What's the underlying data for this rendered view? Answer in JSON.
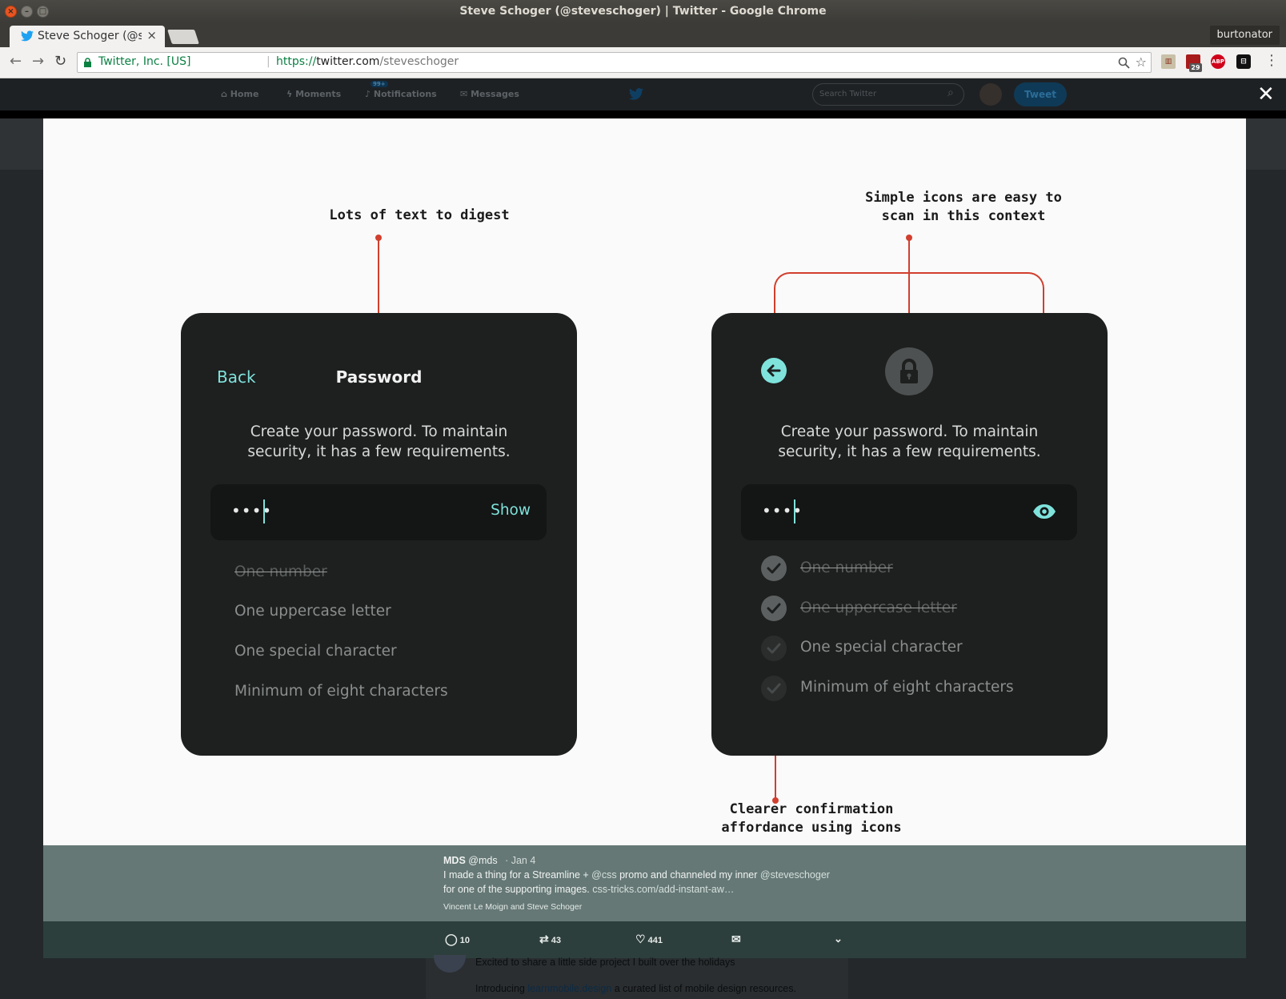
{
  "window": {
    "title": "Steve Schoger (@steveschoger) | Twitter - Google Chrome"
  },
  "browser": {
    "tab_title": "Steve Schoger (@st",
    "tab_close": "×",
    "profile": "burtonator",
    "security_label": "Twitter, Inc. [US]",
    "url_scheme": "https://",
    "url_host": "twitter.com",
    "url_path": "/steveschoger",
    "ext_badge": "29",
    "ext_abp": "ABP"
  },
  "twitter_nav": {
    "home": "Home",
    "moments": "Moments",
    "notifications": "Notifications",
    "notifications_badge": "99+",
    "messages": "Messages",
    "search_placeholder": "Search Twitter",
    "tweet_button": "Tweet"
  },
  "slide": {
    "annotation_left": "Lots of text to digest",
    "annotation_right_1": "Simple icons are easy to",
    "annotation_right_2": "scan in this context",
    "annotation_bottom_1": "Clearer confirmation",
    "annotation_bottom_2": "affordance using icons",
    "left_card": {
      "back": "Back",
      "title": "Password",
      "desc_1": "Create your password. To maintain",
      "desc_2": "security, it has a few requirements.",
      "password_mask": "••••",
      "show": "Show",
      "requirements": [
        "One number",
        "One uppercase letter",
        "One special character",
        "Minimum of eight characters"
      ]
    },
    "right_card": {
      "desc_1": "Create your password. To maintain",
      "desc_2": "security, it has a few requirements.",
      "password_mask": "••••",
      "requirements": [
        "One number",
        "One uppercase letter",
        "One special character",
        "Minimum of eight characters"
      ]
    }
  },
  "tweet": {
    "author": "MDS",
    "handle": "@mds",
    "date": "· Jan 4",
    "line1_a": "I made a thing for a Streamline + ",
    "line1_mention1": "@css",
    "line1_b": " promo and channeled my inner ",
    "line1_mention2": "@steveschoger",
    "line2_a": "for one of the supporting images. ",
    "line2_link": "css-tricks.com/add-instant-aw…",
    "likers_a": "Vincent Le Moign",
    "likers_and": " and ",
    "likers_b": "Steve Schoger",
    "replies": "10",
    "retweets": "43",
    "likes": "441"
  },
  "below_tweet": {
    "line1": "Excited to share a little side project I built over the holidays",
    "line2_a": "Introducing ",
    "line2_link": "learnmobile.design",
    "line2_b": " a curated list of mobile design resources."
  },
  "colors": {
    "accent_teal": "#7fe3dc",
    "annotation_red": "#d13f2e",
    "card_bg": "#1e1f1f"
  }
}
